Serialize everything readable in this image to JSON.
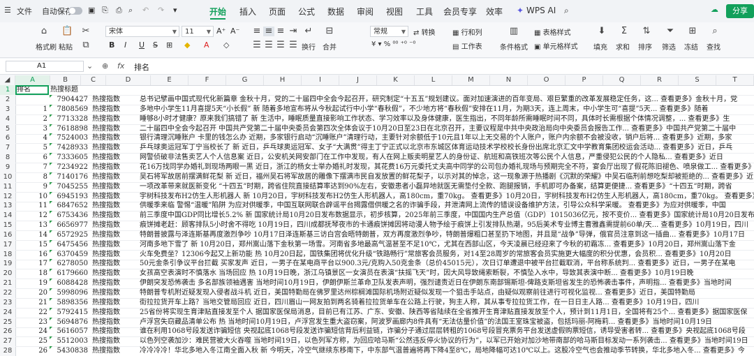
{
  "titlebar": {
    "file": "文件",
    "autosave": "自动保存",
    "menus": [
      "开始",
      "插入",
      "页面",
      "公式",
      "数据",
      "审阅",
      "视图",
      "工具",
      "会员专享",
      "效率"
    ],
    "active_menu": "开始",
    "wps_ai": "WPS AI",
    "share": "分享"
  },
  "ribbon": {
    "format_painter": "格式刷",
    "paste": "粘贴",
    "font_name": "宋体",
    "font_size": "11",
    "bold": "B",
    "italic": "I",
    "underline": "U",
    "wrap": "换行",
    "merge": "合并",
    "number_format": "常规",
    "convert": "转换",
    "row_col": "行和列",
    "worksheet": "工作表",
    "cond_format": "条件格式",
    "table_style": "表格样式",
    "cell_style": "单元格样式",
    "fill": "填充",
    "sum": "求和",
    "sort": "排序",
    "filter": "筛选",
    "freeze": "冻结",
    "find": "查找"
  },
  "formula_bar": {
    "cell_ref": "A1",
    "fx": "fx",
    "content": "排名"
  },
  "columns": [
    "A",
    "B",
    "C",
    "D",
    "E",
    "F",
    "G",
    "H",
    "I",
    "J",
    "K",
    "L",
    "M",
    "N",
    "O",
    "P",
    "Q",
    "R",
    "S",
    "T",
    "U",
    "V",
    "W"
  ],
  "header_row": {
    "a": "排名",
    "b": "热搜标题"
  },
  "rows": [
    {
      "n": "2",
      "a": "",
      "b": "7904427",
      "c": "热搜指数",
      "d": "总书记擘画中国式现代化新篇章  金秋十月，党的二十届四中全会今起召开，研究制定“十五五”规划建议。面对加速演进的百年变局、艰巨繁重的改革发展稳定任务，这... 查看更多》金秋十月，党"
    },
    {
      "n": "3",
      "a": "1",
      "b": "7808569",
      "c": "热搜指数",
      "d": "多地中小学生11月喜提5天“小长假”  新  随着多地宣布将从今秋起试行中小学“春秋假”，不少地方将“春秋假”安排在11月，为期3天，连上周末，中小学生可“喜提”5天... 查看更多》随着"
    },
    {
      "n": "4",
      "a": "2",
      "b": "7713328",
      "c": "热搜指数",
      "d": "睡够8小时才健康？原来我们搞错了  新  生活中，睡眠质量直接影响工作状态、学习效率以及身体健康，医生指出，不同年龄所需睡眠时间不同，具体时长需根据个体情况调整，... 查看更多》生"
    },
    {
      "n": "5",
      "a": "3",
      "b": "7618898",
      "c": "热搜指数",
      "d": "二十届四中全会今起召开  中国共产党第二十届中央委员会第四次全体会议于10月20日至23日在北京召开，主要议程是中共中央政治局向中央委员会报告工作... 查看更多》中国共产党第二十届中"
    },
    {
      "n": "6",
      "a": "4",
      "b": "7524003",
      "c": "热搜指数",
      "d": "银行清理沉睡账户 卡里的钱怎么办  近期，多家银行启动“沉睡账户”清理行动，主要针对余额低于10元且1年以上无交易的个人账户，账户内余额不会被没收，销户后将... 查看更多》近期，多家"
    },
    {
      "n": "7",
      "a": "5",
      "b": "7428933",
      "c": "热搜指数",
      "d": "乒乓球奥运冠军丁宁当校长了  新  近日，乒乓球奥运冠军、女子“大满贯”得主丁宁正式以北京市东城区体育运动技术学校校长身份出席北京汇文中学教育集团校运会活动... 查看更多》近日，乒乓"
    },
    {
      "n": "8",
      "a": "6",
      "b": "7333605",
      "c": "热搜指数",
      "d": "网警侦破非法售卖艺人个人信息案  近日，公安机关网安部门在工作中发现，有人在网上贩卖明星艺人的身份证、航班和高铁班次等公民个人信息，严重侵犯公民的个人隐私... 查看更多》近日"
    },
    {
      "n": "9",
      "a": "7",
      "b": "7234922",
      "c": "热搜指数",
      "d": "花16万找同学办婚礼到现场两眼一黑  近日，浙江的杨女士举办婚礼时发现，其花费16万元委托丈夫高中同学的公司包办婚礼现场与预期完全不符，宴会厅出现了假花陈旧褪色、喷泉做工... 查看更多》近日"
    },
    {
      "n": "10",
      "a": "8",
      "b": "7140176",
      "c": "热搜指数",
      "d": "吴石将军故居前摆满鲜花梨  新  近日，福州吴石将军故居的雕像下摆满市民自发放置的鲜花梨子，以示对其的悼念，这一现象源于热播剧《沉默的荣耀》中吴石临刑前想吃梨却被拒绝的... 查看更多》近日"
    },
    {
      "n": "11",
      "a": "9",
      "b": "7045255",
      "c": "热搜指数",
      "d": "一项改革带来就医新变化  “十四五”时期，跨省住院直接结算率达到90%左右，安徽患者小磊异地就医无需垫付全款、跑腿报销，手机即可办备案，结算更便捷... 查看更多》“十四五”时期，跨省"
    },
    {
      "n": "12",
      "a": "10",
      "b": "6945193",
      "c": "热搜指数",
      "d": "宇树科技发布H2仿生人形机器人  新  10月20日，宇树科技发布H2仿生人形机器人，高180cm，重70kg。 查看更多》10月20日，宇树科技发布H2仿生人形机器人，高180cm，重70kg。 查看更多》"
    },
    {
      "n": "13",
      "a": "11",
      "b": "6847652",
      "c": "热搜指数",
      "d": "供暖季来临 警惕“温暖”陷阱  为应对供暖季，中国互联网联合辟谣平台揭露借供暖之名的诈骗手段，并泄清网上流传的错误设备维护方法，引导公众科学采暖。 查看更多》为应对供暖季，中国"
    },
    {
      "n": "14",
      "a": "12",
      "b": "6753436",
      "c": "热搜指数",
      "d": "前三季度中国GDP同比增长5.2%  新  国家统计局10月20日发布数据显示，初步核算，2025年前三季度，中国国内生产总值（GDP）1015036亿元，按不变价... 查看更多》国家统计局10月20日发布"
    },
    {
      "n": "15",
      "a": "13",
      "b": "6656977",
      "c": "热搜指数",
      "d": "痕饼摊老赶：顾客排队5小时舍不得吃  10月19日，四川成都抚琴夜市的卡通痕饼摊因将动漫人物予绘于痕饼上引发排队热潮，95后美术专业博主曹雅鑫需提前60单/天... 查看更多》10月19日，四川"
    },
    {
      "n": "16",
      "a": "14",
      "b": "6572925",
      "c": "热搜指数",
      "d": "特朗普披露与泽连斯基再度激烈争吵  10月17日泽连斯基三访白宫会晤特朗普，双方再度激烈争吵，特朗普爆粗口甚至扔下地图，并且是“战争”导弹，俄官员注意到这一插曲... 查看更多》10月17日"
    },
    {
      "n": "17",
      "a": "15",
      "b": "6475456",
      "c": "热搜指数",
      "d": "河南多地下雪了  新  10月20日，郑州嵩山落下金秋第一场雪。河南省多地最高气温甚至不足10℃，尤其在西部山区，今天凌晨已经迎来了今秋的初霜冻... 查看更多》10月20日，郑州嵩山落下金"
    },
    {
      "n": "18",
      "a": "16",
      "b": "6370459",
      "c": "热搜指数",
      "d": "火车免费坐？12306今起又上新功能  热  10月20日起，国铁集团将优化升级“铁路畅行”常旅客会员服务，对14至28周岁的常旅客会员实施更大幅度的积分优惠，会员积... 查看更多》10月20日"
    },
    {
      "n": "19",
      "a": "17",
      "b": "6278050",
      "c": "热搜指数",
      "d": "50元金条引争议平台拦截 买家发声  近日，一男子在某电商平台以900.3元/克购入50克金条（总价45015元），次日订单遭退中被平台拦截取消，平台称系统判... 查看更多》近日，一男子在某电"
    },
    {
      "n": "20",
      "a": "18",
      "b": "6179660",
      "c": "热搜指数",
      "d": "女孩高空表演时不慎落水 当场回应  热  10月19日晚，浙江乌镇景区一女演员在表演“扶摇飞天”时，因大风导致绳索断裂，不慎坠入水中，导致其表演中断... 查看更多》10月19日晚"
    },
    {
      "n": "21",
      "a": "19",
      "b": "6088428",
      "c": "热搜指数",
      "d": "伊朗突发恐怖袭击 多名部族领袖遇害  当地时间10月19日，伊朗伊斯兰革命卫队发表声明，强烈谴责近日在伊朗东南部锡斯坦-俾路支斯坦省发生的恐怖袭击事件，声明指... 查看更多》当地时间"
    },
    {
      "n": "22",
      "a": "20",
      "b": "5998096",
      "c": "热搜指数",
      "d": "特朗普专机附近疑发现入侵者战斗机  近日，美国特勤局在佛罗里达州棕榈滩国际机场附近疑似发现一个狙击手站点，由疑似观察前往进行可视化监视... 查看更多》近日，美国特勤局"
    },
    {
      "n": "23",
      "a": "21",
      "b": "5898356",
      "c": "热搜指数",
      "d": "街拉拉货开车上路？当地交管局回应  近日，四川眉山一网友拍到两名骑着拉拉货单车在公路上行驶，狗主人称，其从事专拉拉货工作，在一日日主人路... 查看更多》10月19日，四川"
    },
    {
      "n": "24",
      "a": "22",
      "b": "5792415",
      "c": "热搜指数",
      "d": "25省份将实现生育津贴直接发至个人  据国家医保局消息，目前已有江苏、广东、安徽、陕西等省陆续在全省推开生育津贴直接发放至个人，预计到11月1日，全国将有25个... 查看更多》据国家医保"
    },
    {
      "n": "25",
      "a": "23",
      "b": "5694876",
      "c": "热搜指数",
      "d": "卢浮宫失窃藏品清单公布  热  当地时间10月19日，卢浮宫发生重大盗窃案，阿波罗画廊内8件具有“无法估量价值”的法国王室珠宝被盗，包括玛丽-阿梅莉... 查看更多》当地时间10月19日"
    },
    {
      "n": "26",
      "a": "24",
      "b": "5616057",
      "c": "热搜指数",
      "d": "谁在利用1068号段发送诈骗短信  央视起底1068号段发送诈骗短信背后利益链，诈骗分子通过层层转租的1068号段冒充票务平台发送虚假购票短信，诱导受害者转... 查看更多》央视起底1068号段"
    },
    {
      "n": "27",
      "a": "25",
      "b": "5512003",
      "c": "热搜指数",
      "d": "以色列空袭加沙：难民营被大火吞噬  当地时间19日，以色列军方称，为回应哈马斯“公然违反停火协议的行为”，以军已开始对加沙地带南部的哈马斯目标发动一系列袭击... 查看更多》当地时间19日"
    },
    {
      "n": "28",
      "a": "26",
      "b": "5430838",
      "c": "热搜指数",
      "d": "冷冷冷冷！华北多地入冬江南全面入秋  新  今明天，冷空气继续东移南下，中东部气温普遍将再下降4至8℃，局地降幅可达10℃以上。这股冷空气也会推动季节转换，华北多地入冬... 查看更多》今"
    }
  ]
}
